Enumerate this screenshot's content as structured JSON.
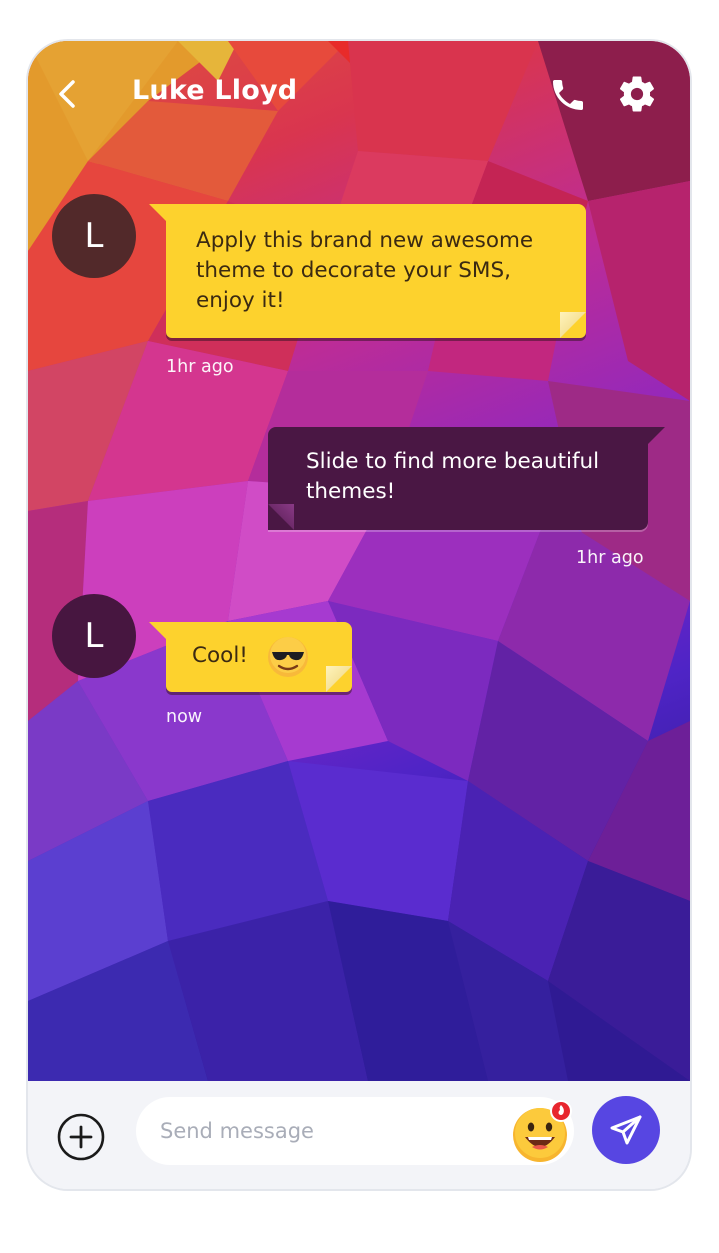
{
  "header": {
    "contact_name": "Luke Lloyd",
    "back_icon": "chevron-left-icon",
    "call_icon": "phone-icon",
    "settings_icon": "gear-icon"
  },
  "messages": [
    {
      "direction": "incoming",
      "avatar_initial": "L",
      "text": "Apply this brand new awesome theme to decorate your SMS, enjoy it!",
      "time": "1hr ago"
    },
    {
      "direction": "outgoing",
      "text": "Slide to find more beautiful themes!",
      "time": "1hr ago"
    },
    {
      "direction": "incoming",
      "avatar_initial": "L",
      "text": "Cool!",
      "emoji": "smiling-face-with-sunglasses",
      "time": "now"
    }
  ],
  "composer": {
    "placeholder": "Send message",
    "add_icon": "plus-circle-icon",
    "sticker_icon": "grinning-face-sticker-icon",
    "send_icon": "paper-plane-icon"
  },
  "colors": {
    "incoming_bubble": "#fdd22d",
    "outgoing_bubble": "#4a1744",
    "send_button": "#5746e2",
    "composer_background": "#f3f4f8"
  }
}
